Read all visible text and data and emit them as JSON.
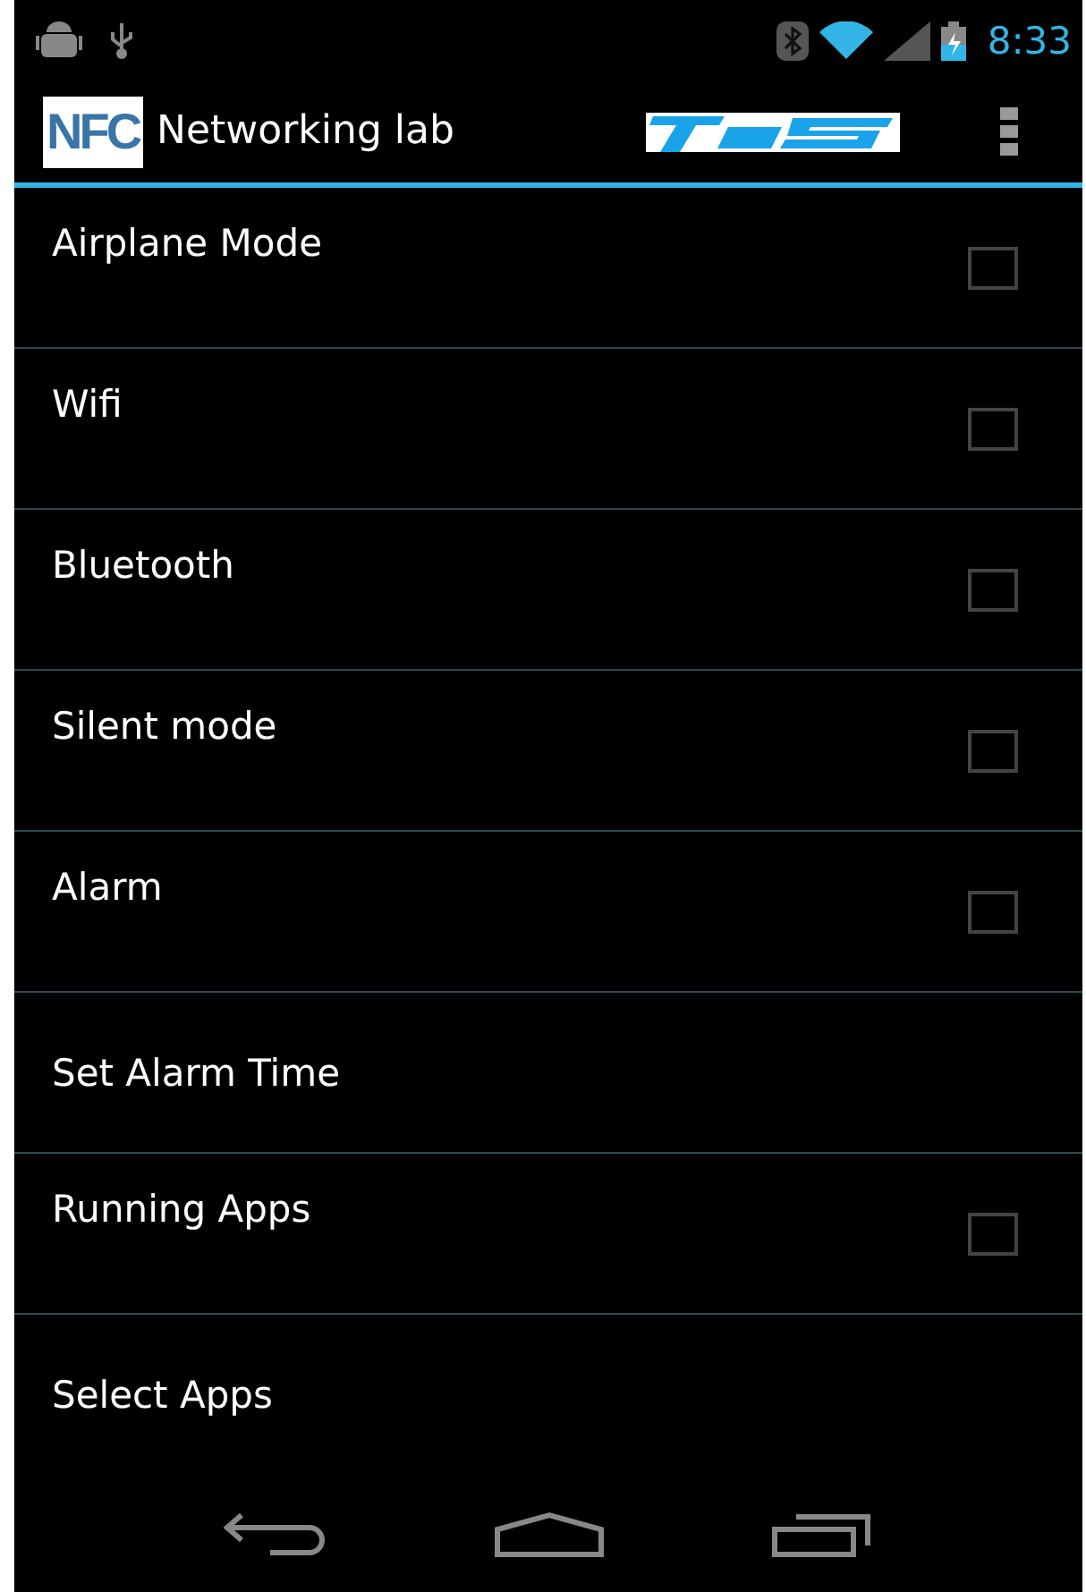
{
  "status_bar": {
    "time": "8:33"
  },
  "action_bar": {
    "logo": "NFC",
    "title": "Networking lab"
  },
  "settings": [
    {
      "kind": "checkbox",
      "label": "Airplane Mode",
      "checked": false
    },
    {
      "kind": "checkbox",
      "label": "Wifi",
      "checked": false
    },
    {
      "kind": "checkbox",
      "label": "Bluetooth",
      "checked": false
    },
    {
      "kind": "checkbox",
      "label": "Silent mode",
      "checked": false
    },
    {
      "kind": "checkbox",
      "label": "Alarm",
      "checked": false
    },
    {
      "kind": "action",
      "label": "Set Alarm Time"
    },
    {
      "kind": "checkbox",
      "label": "Running Apps",
      "checked": false
    },
    {
      "kind": "action",
      "label": "Select Apps"
    }
  ]
}
